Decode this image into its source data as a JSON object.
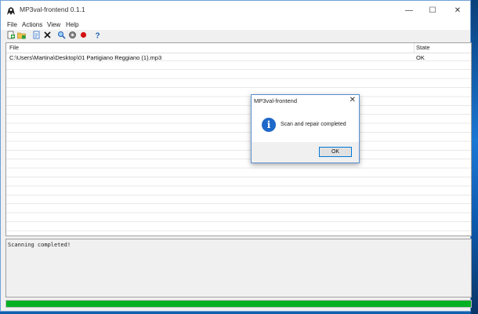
{
  "window": {
    "title": "MP3val-frontend 0.1.1"
  },
  "menu": [
    "File",
    "Actions",
    "View",
    "Help"
  ],
  "toolbar_icons": [
    "add-files-icon",
    "add-folder-icon",
    "info-icon",
    "remove-icon",
    "scan-icon",
    "repair-icon",
    "stop-icon",
    "help-icon"
  ],
  "file_table": {
    "columns": [
      "File",
      "State"
    ],
    "rows": [
      {
        "file": "C:\\Users\\Martina\\Desktop\\01 Partigiano Reggiano  (1).mp3",
        "state": "OK"
      }
    ]
  },
  "log": {
    "text": "Scanning completed!"
  },
  "progress": {
    "value_percent": 100,
    "color": "#06b025"
  },
  "dialog": {
    "title": "MP3val-frontend",
    "message": "Scan and repair completed",
    "ok_label": "OK",
    "icon": "info-icon"
  }
}
